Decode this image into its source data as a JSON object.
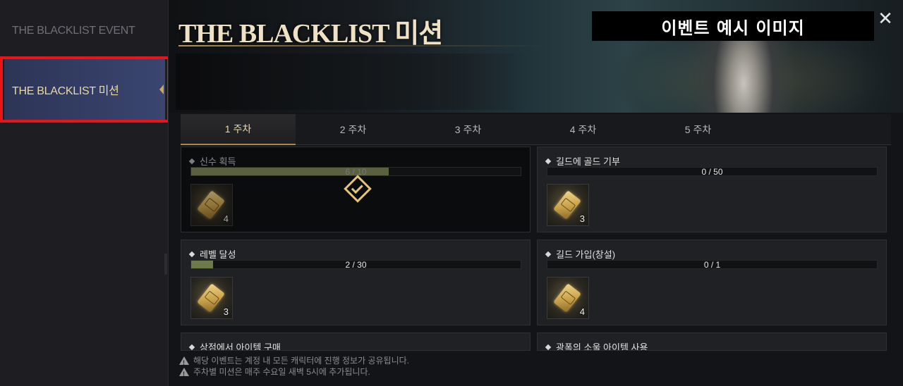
{
  "sidebar": {
    "items": [
      {
        "label": "THE BLACKLIST EVENT"
      },
      {
        "label": "THE BLACKLIST 미션"
      }
    ]
  },
  "banner": {
    "title": "THE BLACKLIST 미션",
    "sample_label": "이벤트 예시 이미지"
  },
  "tabs": [
    "1 주차",
    "2 주차",
    "3 주차",
    "4 주차",
    "5 주차"
  ],
  "missions": [
    {
      "title": "신수 획득",
      "progress_text": "6 / 10",
      "progress": 0.6,
      "reward_count": "4",
      "completed": true
    },
    {
      "title": "길드에 골드 기부",
      "progress_text": "0 / 50",
      "progress": 0,
      "reward_count": "3",
      "completed": false
    },
    {
      "title": "레벨 달성",
      "progress_text": "2 / 30",
      "progress": 0.0667,
      "reward_count": "3",
      "completed": false
    },
    {
      "title": "길드 가입(창설)",
      "progress_text": "0 / 1",
      "progress": 0,
      "reward_count": "4",
      "completed": false
    },
    {
      "title": "상점에서 아이템 구매"
    },
    {
      "title": "광폭의 소울 아이템 사용"
    }
  ],
  "notes": [
    "해당 이벤트는 계정 내 모든 캐릭터에 진행 정보가 공유됩니다.",
    "주차별 미션은 매주 수요일 새벽 5시에 추가됩니다."
  ],
  "colors": {
    "highlight": "#e8141a",
    "gold": "#c9a85a",
    "progress": "#6e7a4a"
  },
  "icons": [
    "close-icon",
    "warning-icon",
    "check-icon",
    "ticket-icon"
  ]
}
